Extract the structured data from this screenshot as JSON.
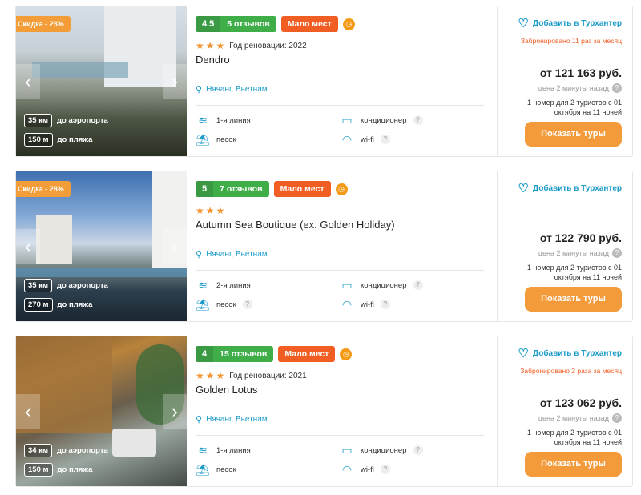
{
  "colors": {
    "accent": "#1d9bc9",
    "orange": "#f39a3b",
    "rating_green": "#3fae49",
    "few_red": "#f05e24"
  },
  "hotels": [
    {
      "discount": "Скидка - 23%",
      "score": "4.5",
      "reviews": "5 отзывов",
      "few_places": "Мало мест",
      "stars_text": "★★★",
      "renovation": "Год реновации: 2022",
      "name": "Dendro",
      "location": "Нячанг, Вьетнам",
      "airport_distance": "35 км",
      "airport_label": "до аэропорта",
      "beach_distance": "150 м",
      "beach_label": "до пляжа",
      "features": {
        "line": "1-я линия",
        "sand": "песок",
        "ac": "кондиционер",
        "wifi": "wi-fi"
      },
      "favorite": "Добавить в Турхантер",
      "booked": "Забронировано 11 раз за месяц",
      "price": "от 121 163 руб.",
      "price_ago": "цена 2 минуты назад",
      "description": "1 номер для 2 туристов с 01 октября на 11 ночей",
      "button": "Показать туры"
    },
    {
      "discount": "Скидка - 28%",
      "score": "5",
      "reviews": "7 отзывов",
      "few_places": "Мало мест",
      "stars_text": "★★★",
      "renovation": "",
      "name": "Autumn Sea Boutique (ex. Golden Holiday)",
      "location": "Нячанг, Вьетнам",
      "airport_distance": "35 км",
      "airport_label": "до аэропорта",
      "beach_distance": "270 м",
      "beach_label": "до пляжа",
      "features": {
        "line": "2-я линия",
        "sand": "песок",
        "ac": "кондиционер",
        "wifi": "wi-fi"
      },
      "favorite": "Добавить в Турхантер",
      "booked": "",
      "price": "от 122 790 руб.",
      "price_ago": "цена 2 минуты назад",
      "description": "1 номер для 2 туристов с 01 октября на 11 ночей",
      "button": "Показать туры"
    },
    {
      "discount": "",
      "score": "4",
      "reviews": "15 отзывов",
      "few_places": "Мало мест",
      "stars_text": "★★★",
      "renovation": "Год реновации: 2021",
      "name": "Golden Lotus",
      "location": "Нячанг, Вьетнам",
      "airport_distance": "34 км",
      "airport_label": "до аэропорта",
      "beach_distance": "150 м",
      "beach_label": "до пляжа",
      "features": {
        "line": "1-я линия",
        "sand": "песок",
        "ac": "кондиционер",
        "wifi": "wi-fi"
      },
      "favorite": "Добавить в Турхантер",
      "booked": "Забронировано 2 раза за месяц",
      "price": "от 123 062 руб.",
      "price_ago": "цена 2 минуты назад",
      "description": "1 номер для 2 туристов с 01 октября на 11 ночей",
      "button": "Показать туры"
    }
  ]
}
